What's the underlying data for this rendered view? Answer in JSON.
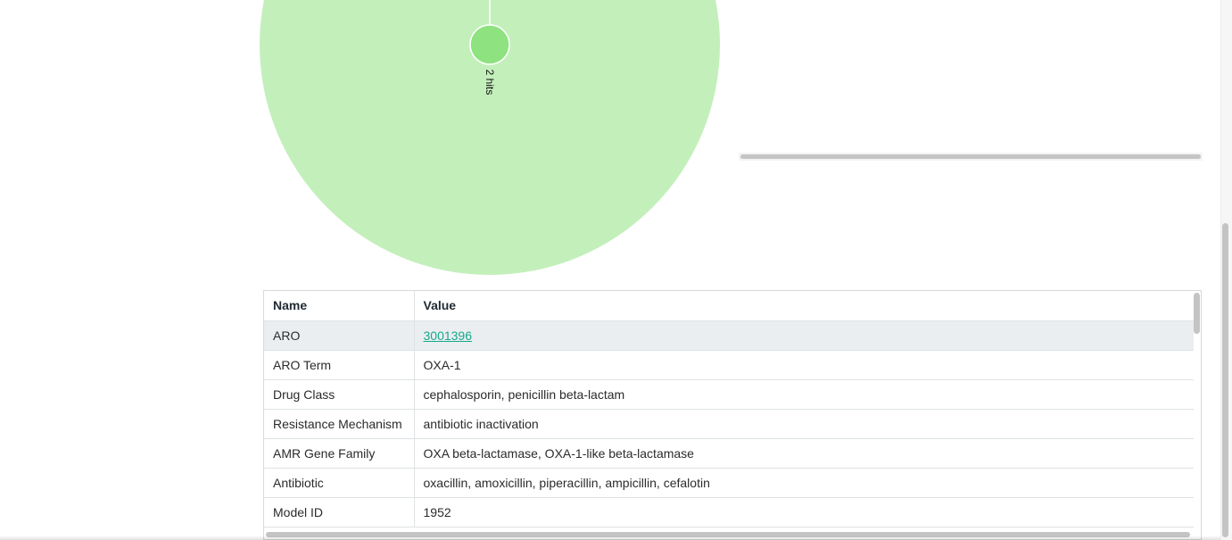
{
  "sunburst": {
    "outer_fill": "#c3efbb",
    "node_fill": "#8ee27f",
    "node_label": "2 hits"
  },
  "table": {
    "headers": {
      "name": "Name",
      "value": "Value"
    },
    "rows": [
      {
        "name": "ARO",
        "value": "3001396",
        "is_link": true
      },
      {
        "name": "ARO Term",
        "value": "OXA-1"
      },
      {
        "name": "Drug Class",
        "value": "cephalosporin, penicillin beta-lactam"
      },
      {
        "name": "Resistance Mechanism",
        "value": "antibiotic inactivation"
      },
      {
        "name": "AMR Gene Family",
        "value": "OXA beta-lactamase, OXA-1-like beta-lactamase"
      },
      {
        "name": "Antibiotic",
        "value": "oxacillin, amoxicillin, piperacillin, ampicillin, cefalotin"
      },
      {
        "name": "Model ID",
        "value": "1952"
      }
    ],
    "link_color": "#17a98c"
  }
}
